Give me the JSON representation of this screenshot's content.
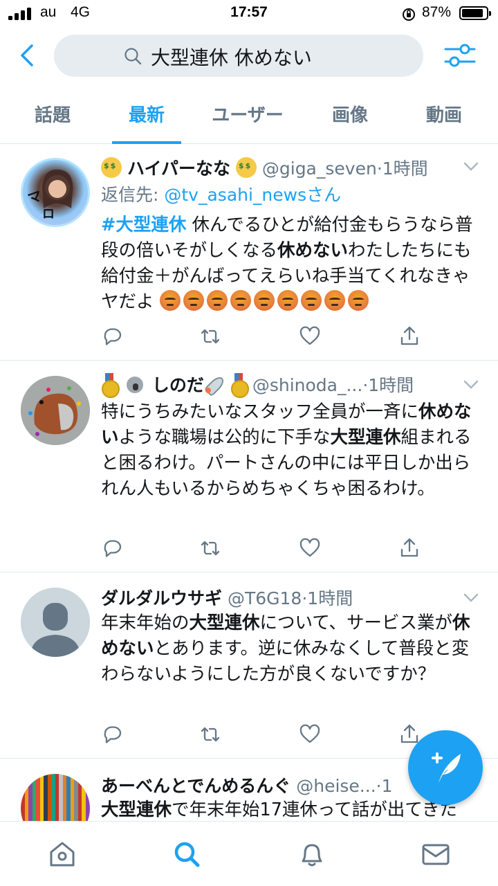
{
  "status": {
    "carrier": "au",
    "network": "4G",
    "time": "17:57",
    "battery_percent": 87,
    "battery_text": "87%"
  },
  "search": {
    "query": "大型連休 休めない"
  },
  "tabs": [
    {
      "label": "話題",
      "active": false
    },
    {
      "label": "最新",
      "active": true
    },
    {
      "label": "ユーザー",
      "active": false
    },
    {
      "label": "画像",
      "active": false
    },
    {
      "label": "動画",
      "active": false
    }
  ],
  "tweets": [
    {
      "name": "ハイパーなな",
      "handle": "@giga_seven",
      "ago": "1時間",
      "reply_prefix": "返信先: ",
      "reply_to": "@tv_asahi_newsさん",
      "body": {
        "tag": "#大型連休",
        "t1": " 休んでるひとが給付金もらうなら普段の倍いそがしくなる",
        "b1": "休めない",
        "t2": "わたしたちにも給付金＋がんばってえらいね手当てくれなきゃヤだよ"
      }
    },
    {
      "name": "しのだ",
      "handle": "@shinoda_...",
      "ago": "1時間",
      "body": {
        "t1": "特にうちみたいなスタッフ全員が一斉に",
        "b1": "休めない",
        "t2": "ような職場は公的に下手な",
        "b2": "大型連休",
        "t3": "組まれると困るわけ。パートさんの中には平日しか出られん人もいるからめちゃくちゃ困るわけ。"
      }
    },
    {
      "name": "ダルダルウサギ",
      "handle": "@T6G18",
      "ago": "1時間",
      "body": {
        "t1": "年末年始の",
        "b1": "大型連休",
        "t2": "について、サービス業が",
        "b2": "休めない",
        "t3": "とあります。逆に休みなくして普段と変わらないようにした方が良くないですか？"
      }
    },
    {
      "name": "あーべんとでんめるんぐ",
      "handle": "@heise...",
      "ago": "1",
      "body": {
        "b1": "大型連休",
        "t1": "で年末年始17連休って話が出てきた"
      }
    }
  ],
  "icons": {
    "back": "chevron-left-icon",
    "search": "search-icon",
    "filter": "sliders-icon",
    "reply": "reply-icon",
    "retweet": "retweet-icon",
    "like": "heart-icon",
    "share": "share-icon",
    "compose": "compose-feather-icon",
    "home": "home-icon",
    "explore": "search-icon",
    "notifications": "bell-icon",
    "messages": "envelope-icon"
  },
  "colors": {
    "accent": "#1da1f2",
    "muted": "#657786",
    "text": "#14171a",
    "search_bg": "#e6ecf0"
  }
}
